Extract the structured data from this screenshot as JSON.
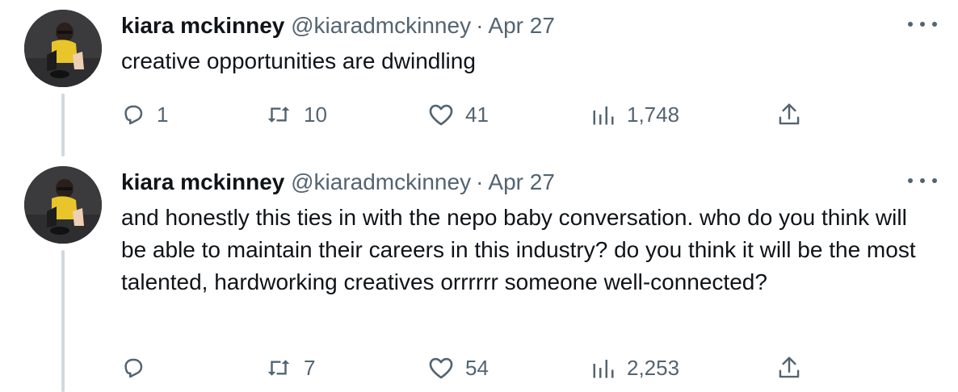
{
  "tweets": [
    {
      "author_name": "kiara mckinney",
      "handle": "@kiaradmckinney",
      "separator": "·",
      "date": "Apr 27",
      "text": "creative opportunities are dwindling",
      "replies": "1",
      "retweets": "10",
      "likes": "41",
      "views": "1,748"
    },
    {
      "author_name": "kiara mckinney",
      "handle": "@kiaradmckinney",
      "separator": "·",
      "date": "Apr 27",
      "text": "and honestly this ties in with the nepo baby conversation. who do you think will be able to maintain their careers in this industry? do you think it will be the most talented, hardworking creatives orrrrrr someone well-connected?",
      "replies": "",
      "retweets": "7",
      "likes": "54",
      "views": "2,253"
    }
  ],
  "icons": {
    "reply": "reply-icon",
    "retweet": "retweet-icon",
    "like": "heart-icon",
    "views": "views-icon",
    "share": "share-icon",
    "more": "more-icon"
  },
  "colors": {
    "text": "#0f1419",
    "secondary": "#536471",
    "thread_line": "#cfd9de"
  }
}
